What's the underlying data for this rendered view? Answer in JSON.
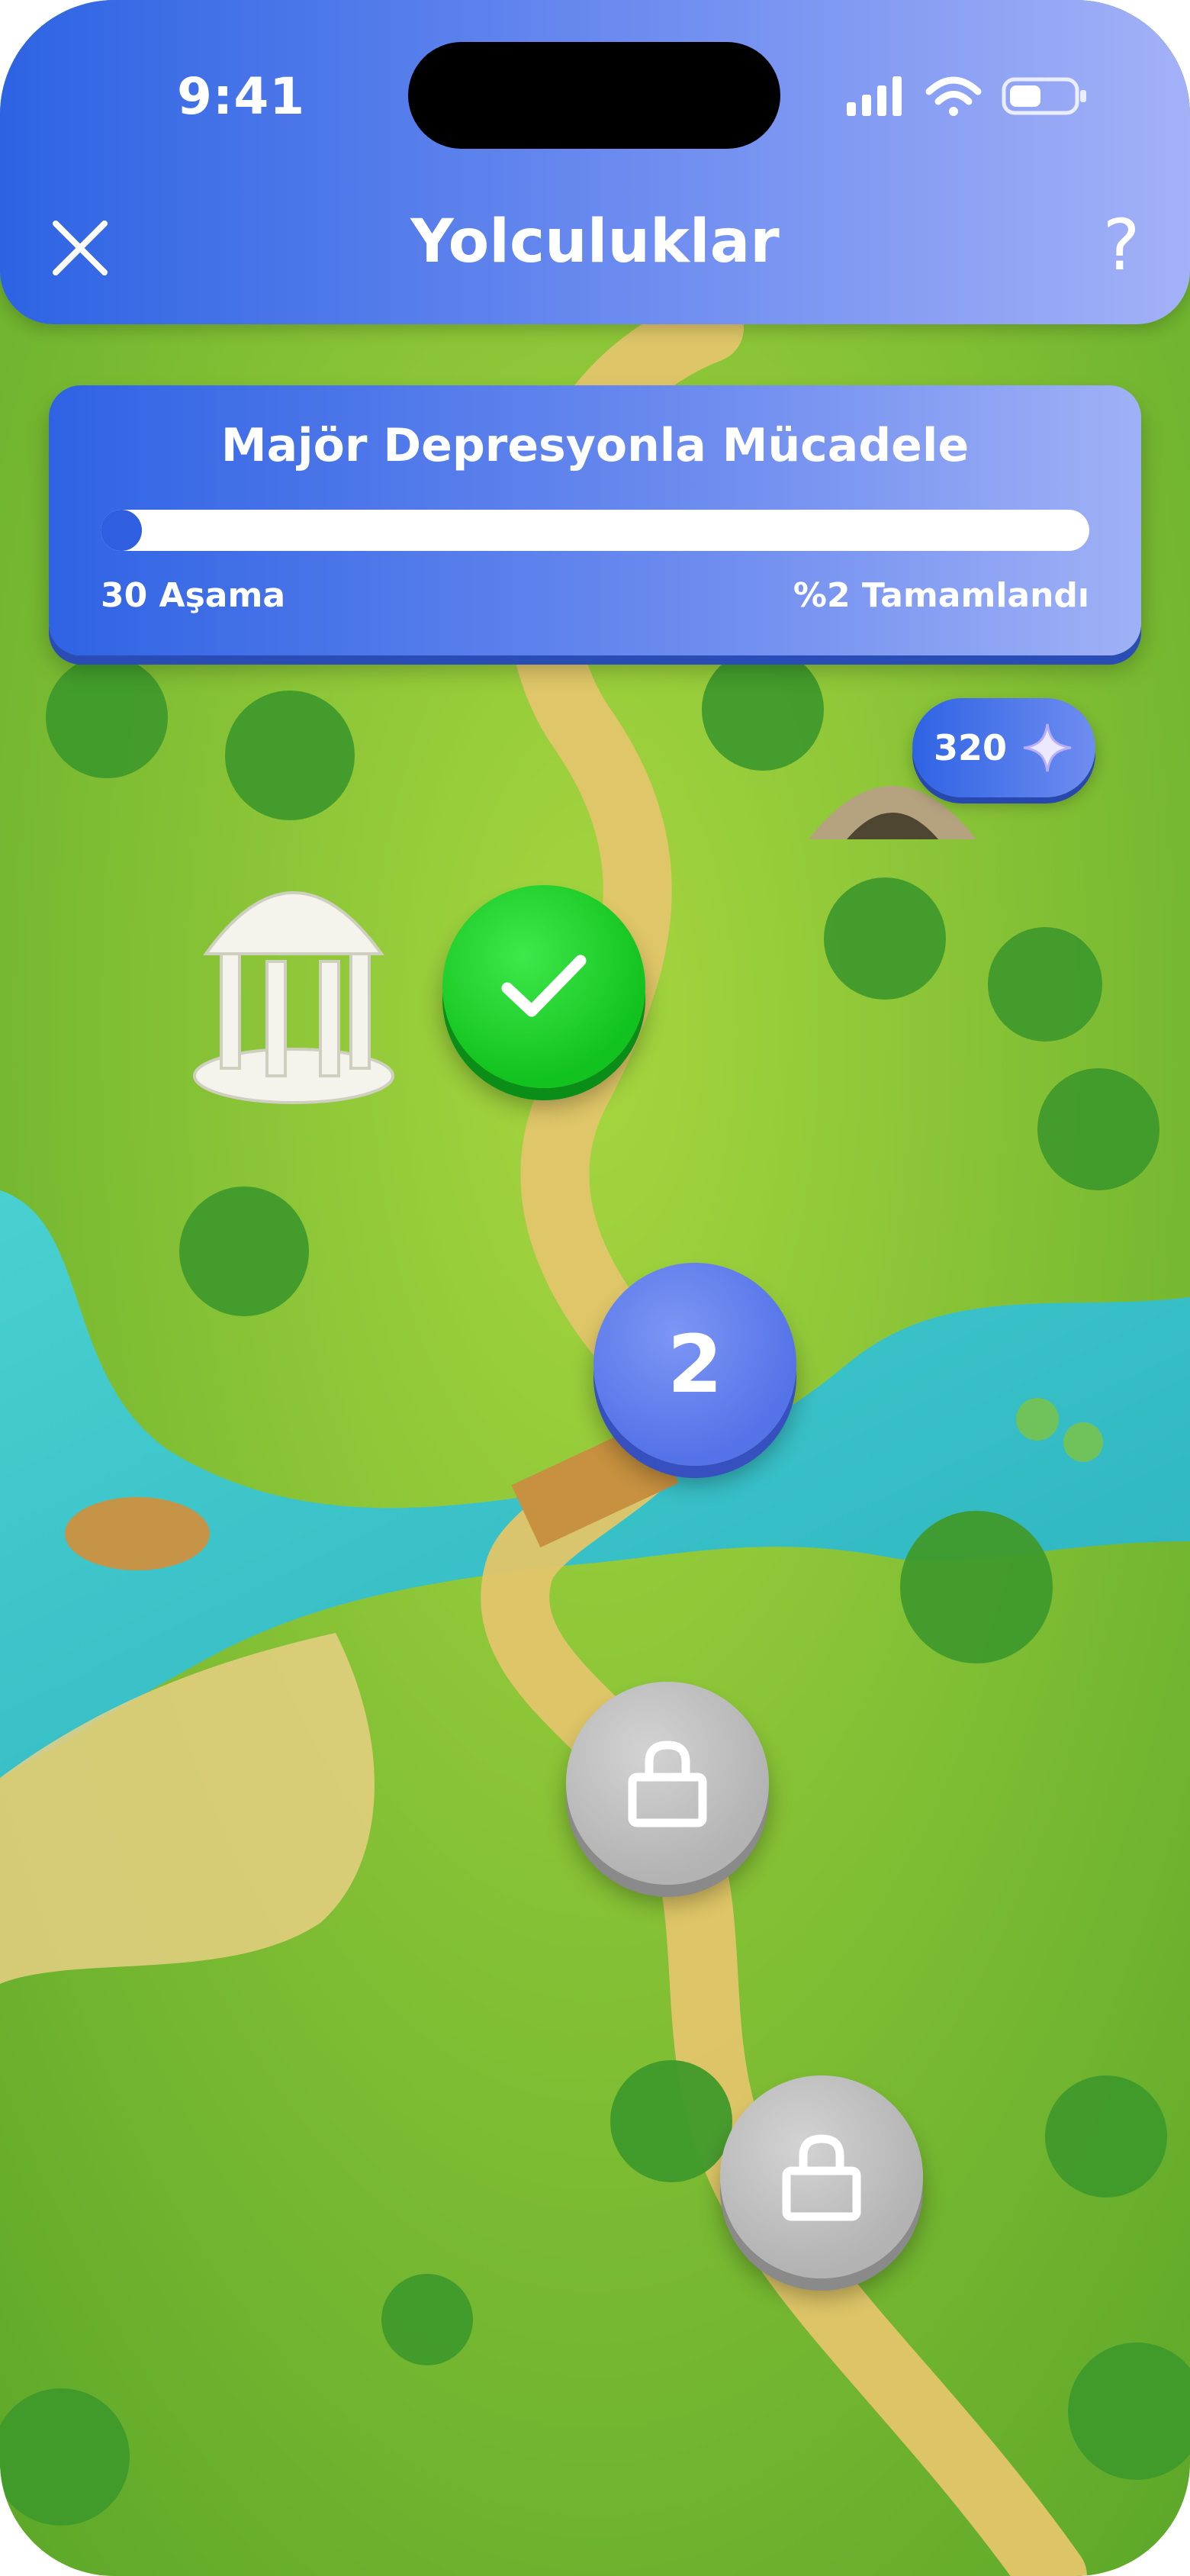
{
  "status_bar": {
    "time": "9:41",
    "icons": [
      "signal-icon",
      "wifi-icon",
      "battery-icon"
    ]
  },
  "header": {
    "title": "Yolculuklar",
    "close_icon": "close-icon",
    "help_label": "?"
  },
  "journey": {
    "title": "Majör Depresyonla Mücadele",
    "stages_label": "30 Aşama",
    "completed_label": "%2 Tamamlandı",
    "progress_fraction": 0.02
  },
  "points": {
    "value": "320",
    "icon": "sparkle-icon"
  },
  "levels": [
    {
      "state": "completed",
      "icon": "check-icon"
    },
    {
      "state": "current",
      "label": "2"
    },
    {
      "state": "locked",
      "icon": "lock-icon"
    },
    {
      "state": "locked",
      "icon": "lock-icon"
    }
  ],
  "colors": {
    "brand_blue": "#2f63e4",
    "brand_blue_light": "#a3b1f7",
    "completed_green": "#12c21e",
    "current_blue": "#5473e8",
    "locked_gray": "#b3b3b3",
    "grass": "#7fc234",
    "water": "#3cc2c8",
    "path": "#e3c56a"
  }
}
